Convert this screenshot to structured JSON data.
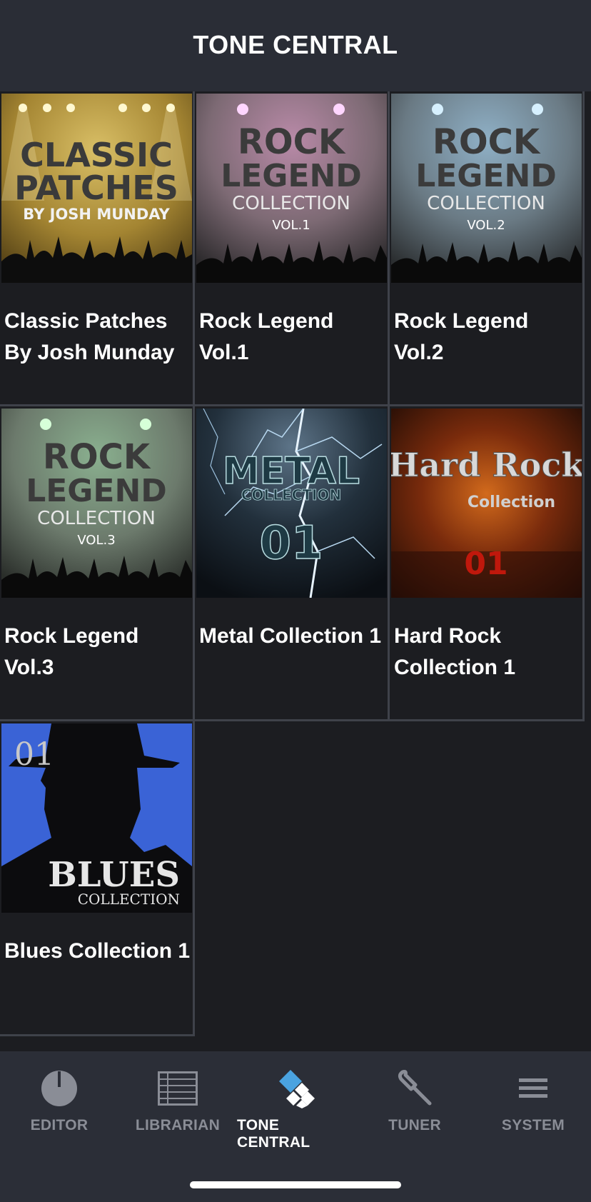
{
  "header": {
    "title": "TONE CENTRAL"
  },
  "packs": [
    {
      "name": "Classic Patches By Josh Munday",
      "art_lines": [
        "CLASSIC",
        "PATCHES",
        "BY JOSH MUNDAY"
      ],
      "art_theme": "gold"
    },
    {
      "name": "Rock Legend Vol.1",
      "art_lines": [
        "ROCK",
        "LEGEND",
        "COLLECTION",
        "VOL.1"
      ],
      "art_theme": "magenta"
    },
    {
      "name": "Rock Legend Vol.2",
      "art_lines": [
        "ROCK",
        "LEGEND",
        "COLLECTION",
        "VOL.2"
      ],
      "art_theme": "blue"
    },
    {
      "name": "Rock Legend Vol.3",
      "art_lines": [
        "ROCK",
        "LEGEND",
        "COLLECTION",
        "VOL.3"
      ],
      "art_theme": "green"
    },
    {
      "name": "Metal Collection 1",
      "art_lines": [
        "METAL",
        "COLLECTION",
        "01"
      ],
      "art_theme": "metal"
    },
    {
      "name": "Hard Rock Collection 1",
      "art_lines": [
        "Hard Rock",
        "Collection",
        "01"
      ],
      "art_theme": "fire"
    },
    {
      "name": "Blues Collection 1",
      "art_lines": [
        "01",
        "BLUES",
        "COLLECTION"
      ],
      "art_theme": "blues"
    }
  ],
  "tabs": [
    {
      "label": "EDITOR",
      "icon": "dial-icon",
      "active": false
    },
    {
      "label": "LIBRARIAN",
      "icon": "list-icon",
      "active": false
    },
    {
      "label": "TONE CENTRAL",
      "icon": "tone-central-icon",
      "active": true
    },
    {
      "label": "TUNER",
      "icon": "tuning-fork-icon",
      "active": false
    },
    {
      "label": "SYSTEM",
      "icon": "menu-icon",
      "active": false
    }
  ],
  "colors": {
    "background": "#1c1d21",
    "header": "#2a2d36",
    "tabbar": "#2b2e37",
    "active_accent": "#4aa3e0",
    "inactive_tab": "#8a8d96"
  }
}
